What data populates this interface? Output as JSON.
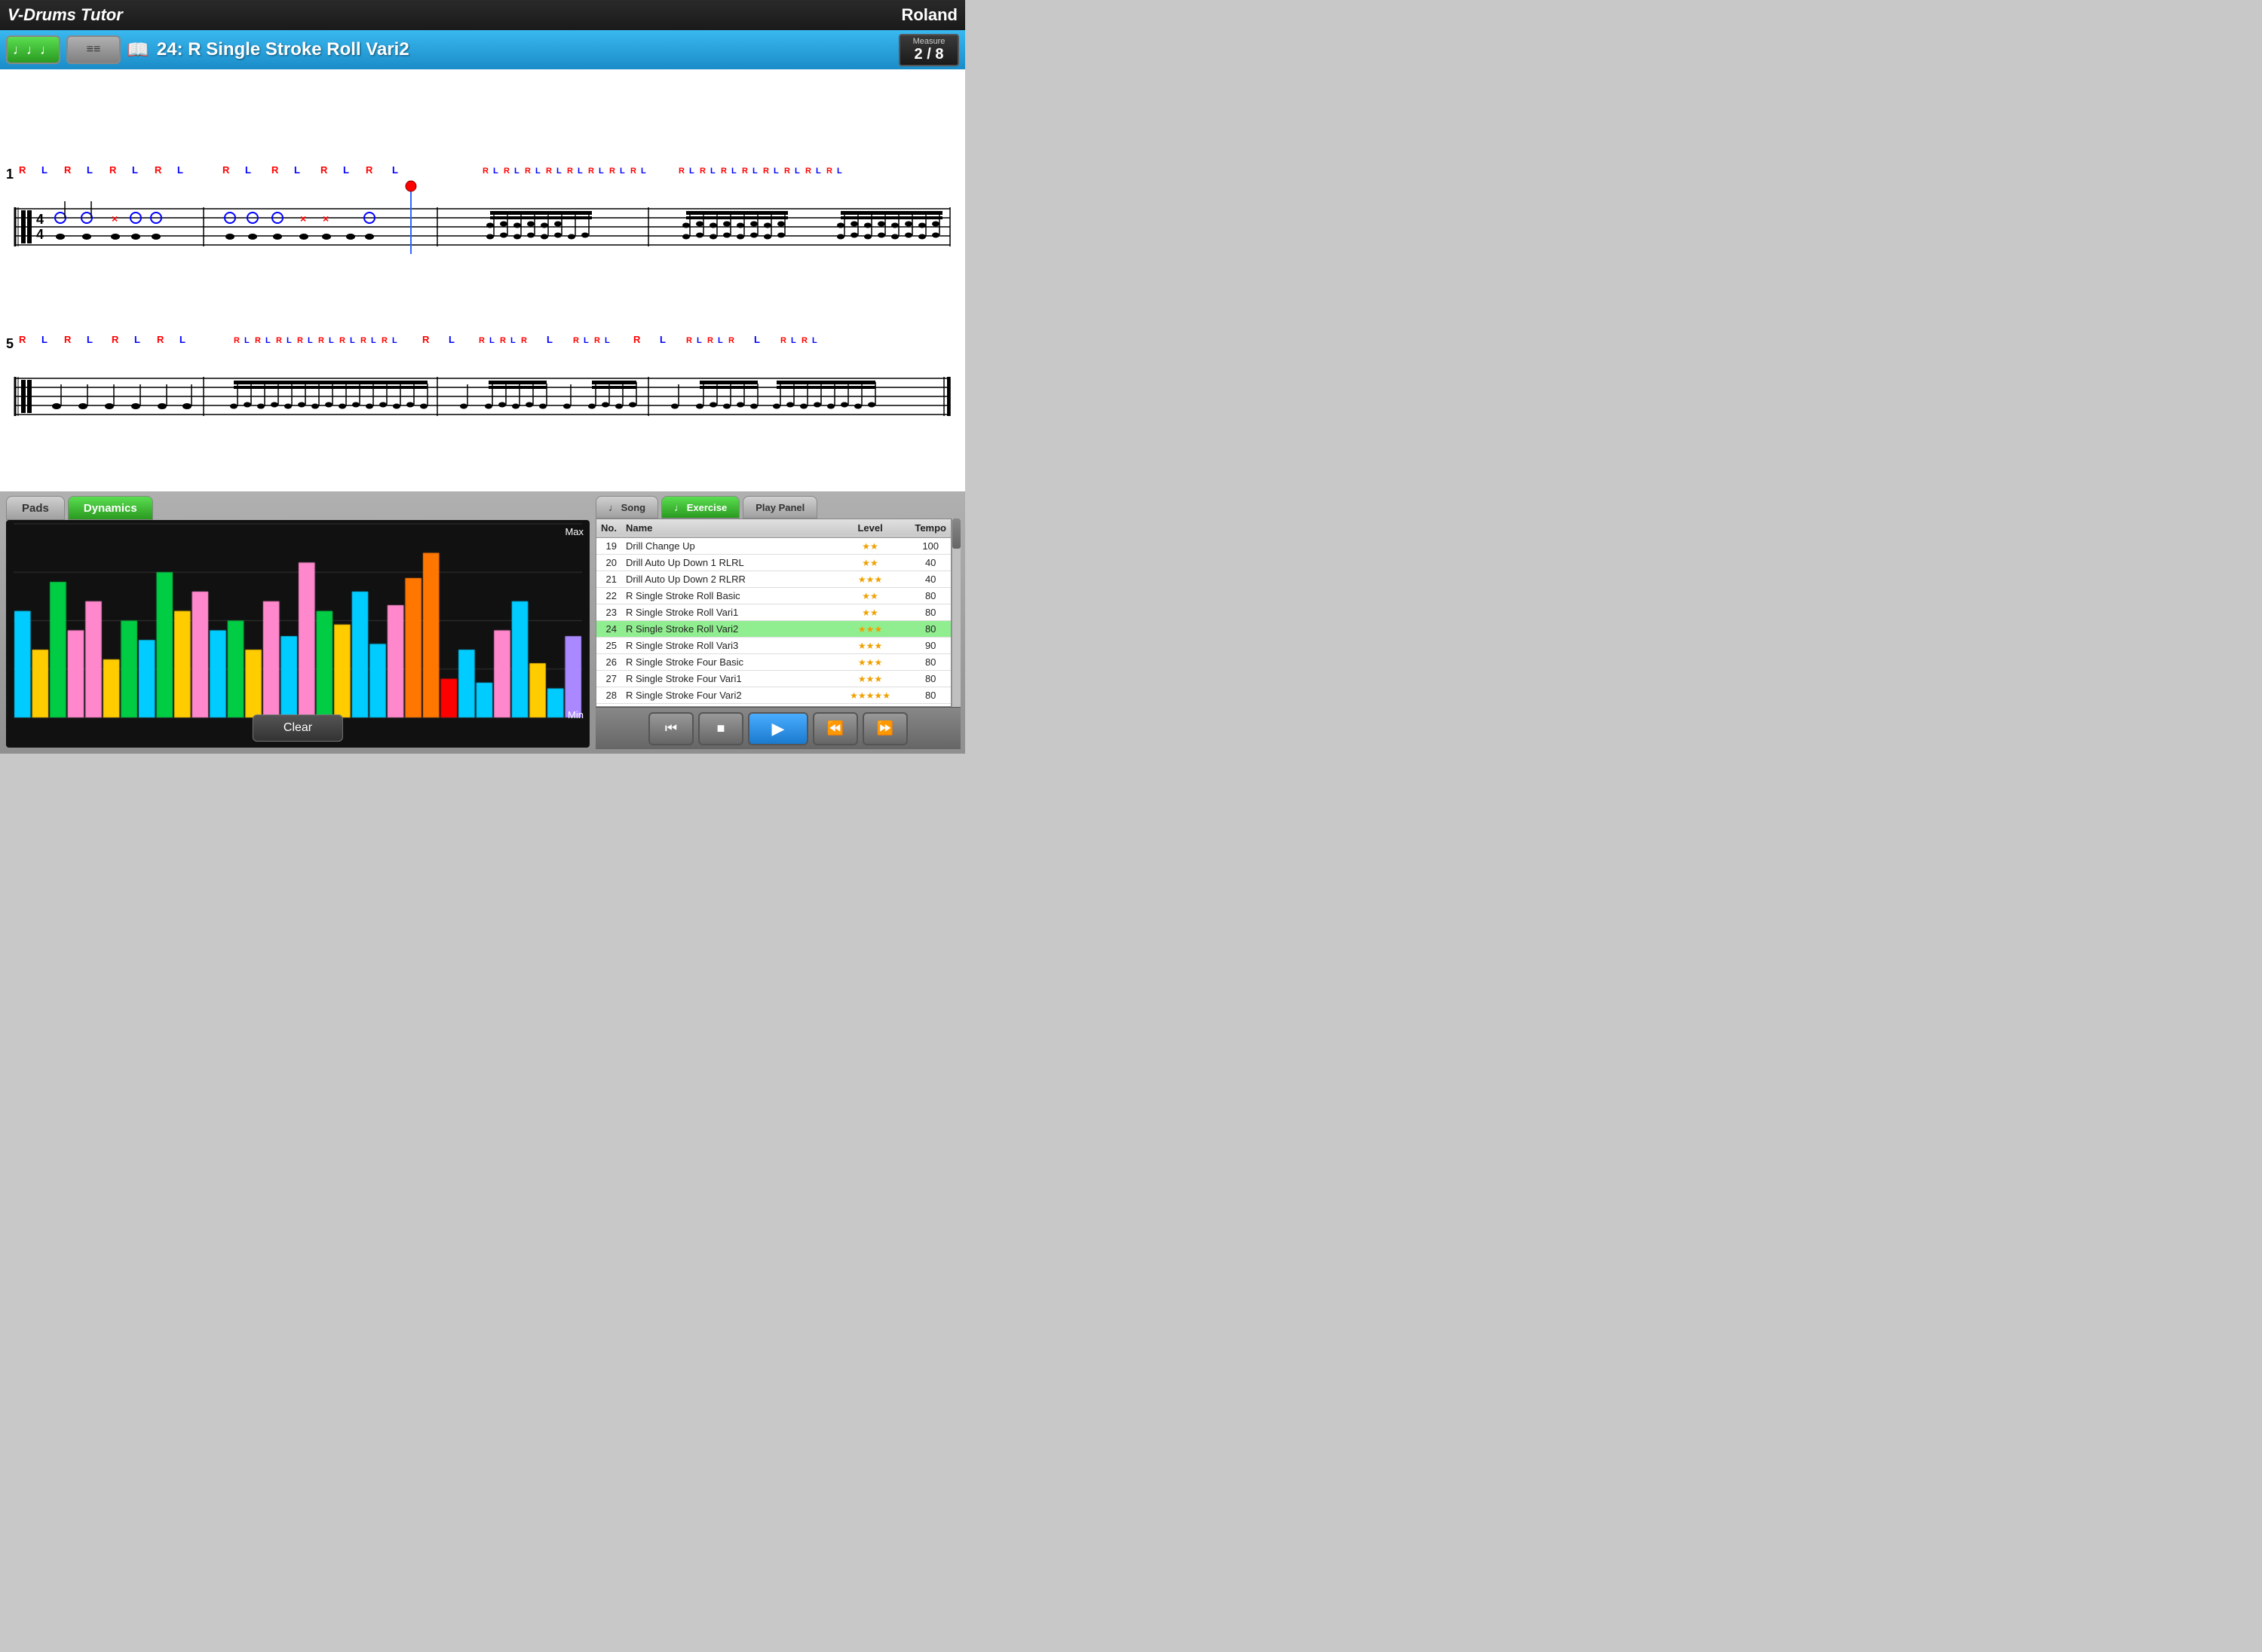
{
  "topBar": {
    "title": "V-Drums Tutor",
    "logo": "Roland"
  },
  "header": {
    "musicBtnLabel": "♪♪♪",
    "listBtnLabel": "≡≡≡",
    "bookIcon": "📖",
    "lessonTitle": "24: R  Single Stroke Roll Vari2",
    "measureLabel": "Measure",
    "measureValue": "2 / 8"
  },
  "scoreRow1": {
    "barNumber": "1",
    "stickings": "R  L  R  L  R  L  R  L       R  L   R  L   R  L  R  L       RLRLRLRLRLRLRLRL   RLRLRLRLRLRLRLRL"
  },
  "scoreRow2": {
    "barNumber": "5",
    "stickings": "R  L  R  L   R  L  R  L       RLRLRLRLRLRLRLRL      R  L   RLRLR  L   RLRL   R  L   RLRLR  L   RLRL"
  },
  "leftPanel": {
    "tabs": [
      {
        "label": "Pads",
        "active": false
      },
      {
        "label": "Dynamics",
        "active": true
      }
    ],
    "chartMaxLabel": "Max",
    "chartMinLabel": "Min",
    "clearBtn": "Clear",
    "bars": [
      {
        "height": 55,
        "color": "#00ccff"
      },
      {
        "height": 35,
        "color": "#ffcc00"
      },
      {
        "height": 70,
        "color": "#00cc44"
      },
      {
        "height": 45,
        "color": "#ff88cc"
      },
      {
        "height": 60,
        "color": "#ff88cc"
      },
      {
        "height": 30,
        "color": "#ffcc00"
      },
      {
        "height": 50,
        "color": "#00cc44"
      },
      {
        "height": 40,
        "color": "#00ccff"
      },
      {
        "height": 75,
        "color": "#00cc44"
      },
      {
        "height": 55,
        "color": "#ffcc00"
      },
      {
        "height": 65,
        "color": "#ff88cc"
      },
      {
        "height": 45,
        "color": "#00ccff"
      },
      {
        "height": 50,
        "color": "#00cc44"
      },
      {
        "height": 35,
        "color": "#ffcc00"
      },
      {
        "height": 60,
        "color": "#ff88cc"
      },
      {
        "height": 42,
        "color": "#00ccff"
      },
      {
        "height": 80,
        "color": "#ff88cc"
      },
      {
        "height": 55,
        "color": "#00cc44"
      },
      {
        "height": 48,
        "color": "#ffcc00"
      },
      {
        "height": 65,
        "color": "#00ccff"
      },
      {
        "height": 38,
        "color": "#00ccff"
      },
      {
        "height": 58,
        "color": "#ff88cc"
      },
      {
        "height": 72,
        "color": "#ff7700"
      },
      {
        "height": 85,
        "color": "#ff7700"
      },
      {
        "height": 20,
        "color": "#ff0000"
      },
      {
        "height": 35,
        "color": "#00ccff"
      },
      {
        "height": 18,
        "color": "#00ccff"
      },
      {
        "height": 45,
        "color": "#ff88cc"
      },
      {
        "height": 60,
        "color": "#00ccff"
      },
      {
        "height": 28,
        "color": "#ffcc00"
      },
      {
        "height": 15,
        "color": "#00ccff"
      },
      {
        "height": 42,
        "color": "#aa88ff"
      }
    ]
  },
  "rightPanel": {
    "tabs": [
      {
        "label": "♩ Song",
        "active": false
      },
      {
        "label": "♩ Exercise",
        "active": true
      },
      {
        "label": "Play Panel",
        "active": false
      }
    ],
    "tableHeaders": [
      "No.",
      "Name",
      "Level",
      "Tempo"
    ],
    "exercises": [
      {
        "no": 19,
        "name": "Drill  Change Up",
        "level": "★★",
        "tempo": 100,
        "selected": false
      },
      {
        "no": 20,
        "name": "Drill  Auto Up Down 1 RLRL",
        "level": "★★",
        "tempo": 40,
        "selected": false
      },
      {
        "no": 21,
        "name": "Drill  Auto Up Down 2 RLRR",
        "level": "★★★",
        "tempo": 40,
        "selected": false
      },
      {
        "no": 22,
        "name": "R  Single Stroke Roll Basic",
        "level": "★★",
        "tempo": 80,
        "selected": false
      },
      {
        "no": 23,
        "name": "R  Single Stroke Roll Vari1",
        "level": "★★",
        "tempo": 80,
        "selected": false
      },
      {
        "no": 24,
        "name": "R  Single Stroke Roll Vari2",
        "level": "★★★",
        "tempo": 80,
        "selected": true
      },
      {
        "no": 25,
        "name": "R  Single Stroke Roll Vari3",
        "level": "★★★",
        "tempo": 90,
        "selected": false
      },
      {
        "no": 26,
        "name": "R  Single Stroke Four Basic",
        "level": "★★★",
        "tempo": 80,
        "selected": false
      },
      {
        "no": 27,
        "name": "R  Single Stroke Four Vari1",
        "level": "★★★",
        "tempo": 80,
        "selected": false
      },
      {
        "no": 28,
        "name": "R  Single Stroke Four Vari2",
        "level": "★★★★★",
        "tempo": 80,
        "selected": false
      }
    ]
  },
  "transport": {
    "skipBackLabel": "⏮",
    "stopLabel": "■",
    "playLabel": "▶",
    "rewindLabel": "⏪",
    "fastForwardLabel": "⏩"
  }
}
